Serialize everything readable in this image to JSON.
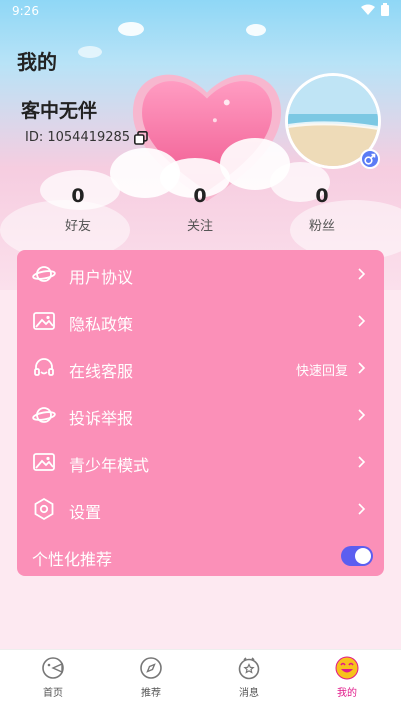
{
  "status_bar": {
    "time": "9:26"
  },
  "header": {
    "title": "我的"
  },
  "profile": {
    "name": "客中无伴",
    "id_text": "ID: 1054419285"
  },
  "stats": [
    {
      "value": "0",
      "label": "好友"
    },
    {
      "value": "0",
      "label": "关注"
    },
    {
      "value": "0",
      "label": "粉丝"
    }
  ],
  "menu": [
    {
      "label": "用户协议",
      "icon": "planet-icon",
      "hint": ""
    },
    {
      "label": "隐私政策",
      "icon": "image-icon",
      "hint": ""
    },
    {
      "label": "在线客服",
      "icon": "headset-icon",
      "hint": "快速回复"
    },
    {
      "label": "投诉举报",
      "icon": "planet-icon",
      "hint": ""
    },
    {
      "label": "青少年模式",
      "icon": "image-icon",
      "hint": ""
    },
    {
      "label": "设置",
      "icon": "hexagon-settings-icon",
      "hint": ""
    }
  ],
  "personalized": {
    "label": "个性化推荐",
    "enabled": true
  },
  "tabs": [
    {
      "label": "首页",
      "icon": "home-face-icon"
    },
    {
      "label": "推荐",
      "icon": "compass-icon"
    },
    {
      "label": "消息",
      "icon": "message-star-icon"
    },
    {
      "label": "我的",
      "icon": "smiley-icon",
      "active": true
    }
  ],
  "colors": {
    "card": "#fb90b8",
    "accent": "#e0198a",
    "toggle": "#5b5ef0"
  }
}
